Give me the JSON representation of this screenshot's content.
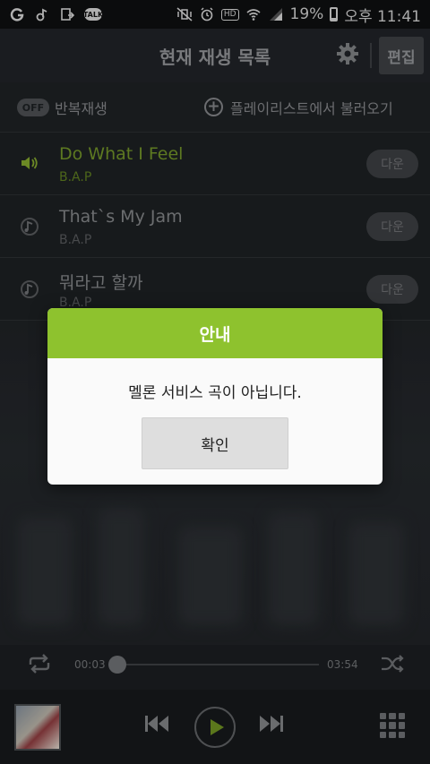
{
  "status_bar": {
    "battery": "19%",
    "time": "오후 11:41",
    "hd": "HD",
    "talk": "TALK",
    "icons": [
      "g-logo-icon",
      "music-note-icon",
      "screen-share-icon",
      "talk-icon",
      "mute-vibrate-icon",
      "alarm-icon",
      "hd-icon",
      "wifi-icon",
      "signal-icon",
      "battery-icon"
    ]
  },
  "header": {
    "title": "현재 재생 목록",
    "edit_label": "편집"
  },
  "subbar": {
    "off_badge": "OFF",
    "repeat_label": "반복재생",
    "load_label": "플레이리스트에서 불러오기"
  },
  "playlist": [
    {
      "title": "Do What I Feel",
      "artist": "B.A.P",
      "download": "다운",
      "active": true
    },
    {
      "title": "That`s My Jam",
      "artist": "B.A.P",
      "download": "다운",
      "active": false
    },
    {
      "title": "뭐라고 할까",
      "artist": "B.A.P",
      "download": "다운",
      "active": false
    }
  ],
  "player": {
    "current_time": "00:03",
    "total_time": "03:54",
    "progress": 0.013
  },
  "dialog": {
    "title": "안내",
    "message": "멜론 서비스 곡이 아닙니다.",
    "confirm_label": "확인"
  },
  "colors": {
    "accent_green": "#8ec22e",
    "background": "#1a1d20"
  }
}
